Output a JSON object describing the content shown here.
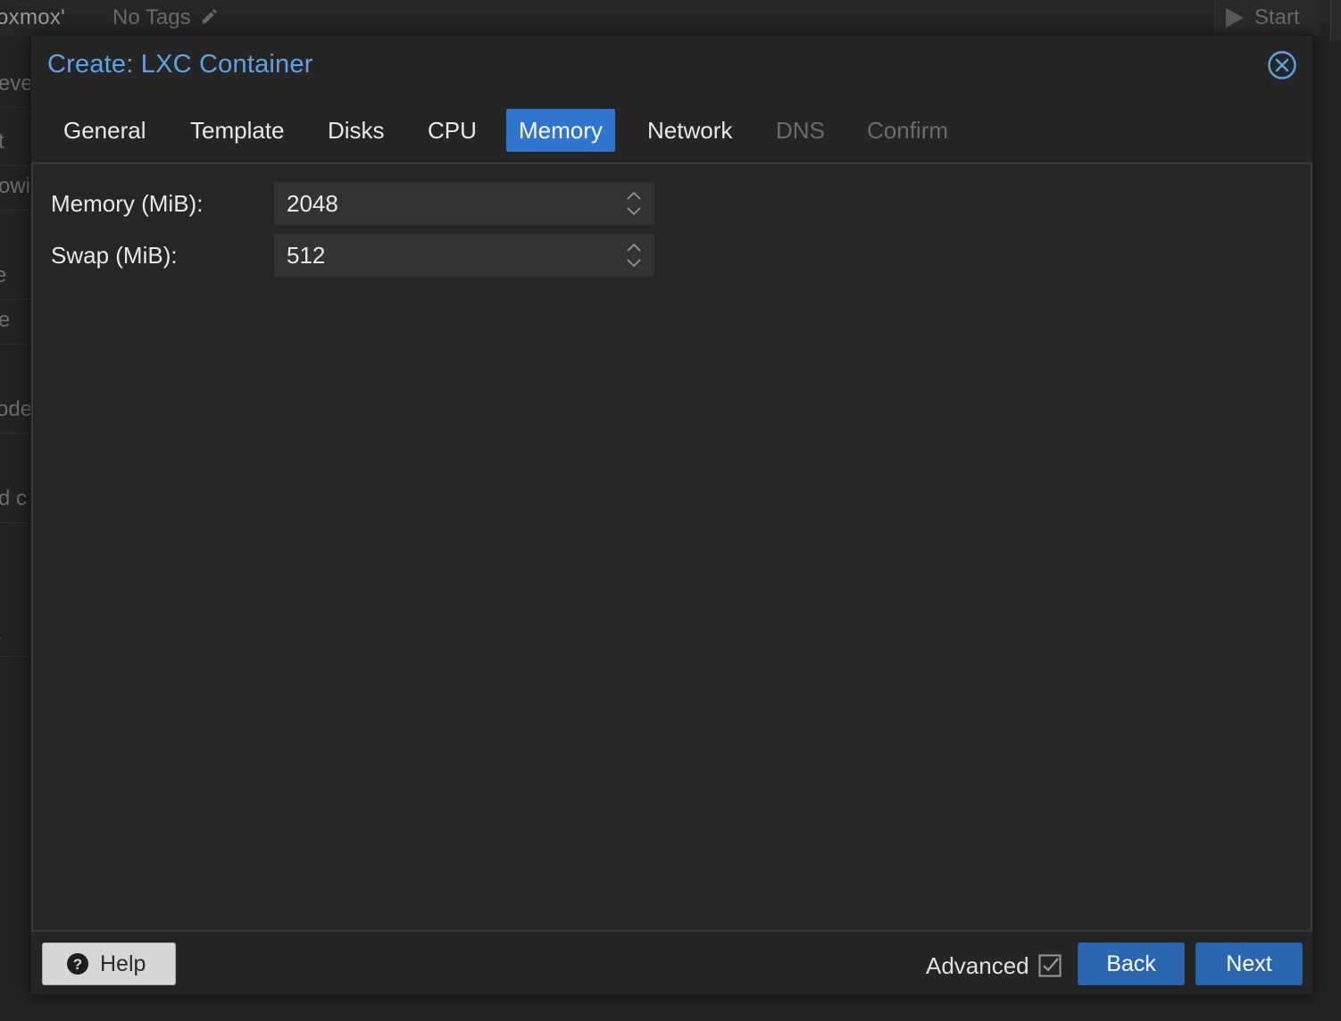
{
  "background": {
    "title": "oxmox'",
    "tags_text": "No Tags",
    "start_label": "Start",
    "left_fragments": [
      "eve",
      "t",
      "owi",
      "e",
      "e",
      "ode",
      "d c",
      "t"
    ]
  },
  "dialog": {
    "title": "Create: LXC Container",
    "tabs": [
      {
        "label": "General",
        "state": "normal"
      },
      {
        "label": "Template",
        "state": "normal"
      },
      {
        "label": "Disks",
        "state": "normal"
      },
      {
        "label": "CPU",
        "state": "normal"
      },
      {
        "label": "Memory",
        "state": "active"
      },
      {
        "label": "Network",
        "state": "normal"
      },
      {
        "label": "DNS",
        "state": "disabled"
      },
      {
        "label": "Confirm",
        "state": "disabled"
      }
    ],
    "fields": {
      "memory": {
        "label": "Memory (MiB):",
        "value": "2048"
      },
      "swap": {
        "label": "Swap (MiB):",
        "value": "512"
      }
    },
    "footer": {
      "help_label": "Help",
      "advanced_label": "Advanced",
      "advanced_checked": true,
      "back_label": "Back",
      "next_label": "Next"
    }
  },
  "colors": {
    "accent": "#2f74cf",
    "title": "#5ea2e5",
    "primary_button": "#2b66b3",
    "disabled_text": "#6b6b6b"
  },
  "icons": {
    "close": "close-circle-icon",
    "help": "question-circle-icon",
    "pencil": "pencil-icon",
    "play": "play-icon",
    "spinner": "spinner-arrows-icon",
    "checkbox": "checkbox-checked-icon"
  }
}
